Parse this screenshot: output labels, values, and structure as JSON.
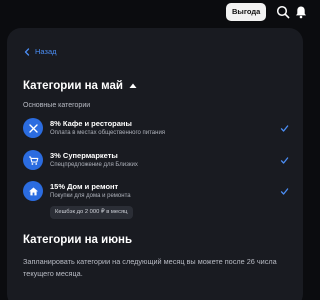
{
  "topbar": {
    "promo_label": "Выгода",
    "icons": [
      "search-icon",
      "bell-icon"
    ]
  },
  "nav": {
    "back_label": "Назад"
  },
  "may": {
    "title": "Категории на май",
    "section_label": "Основные категории",
    "categories": [
      {
        "name": "8% Кафе и рестораны",
        "subtitle": "Оплата в местах общественного питания",
        "icon": "fork-knife-icon",
        "checked": true
      },
      {
        "name": "3% Супермаркеты",
        "subtitle": "Спецпредложение для Близких",
        "icon": "cart-icon",
        "checked": true
      },
      {
        "name": "15% Дом и ремонт",
        "subtitle": "Покупки для дома и ремонта",
        "icon": "house-icon",
        "checked": true,
        "badge": "Кешбэк до 2 000 ₽ в месяц"
      }
    ]
  },
  "june": {
    "title": "Категории на июнь",
    "description": "Запланировать категории на следующий месяц вы можете после 26 числа текущего месяца."
  },
  "colors": {
    "background": "#0b0c0f",
    "panel": "#191b21",
    "accent": "#2b6ce0",
    "link": "#4b8ef5"
  }
}
